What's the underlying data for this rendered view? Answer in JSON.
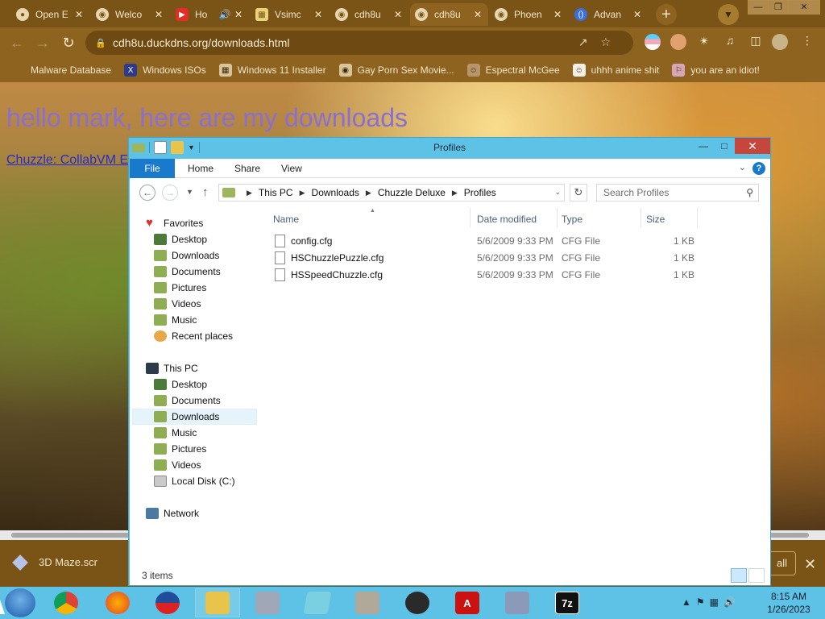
{
  "browser": {
    "tabs": [
      {
        "title": "Open E",
        "icon": "github-icon"
      },
      {
        "title": "Welco",
        "icon": "globe-icon"
      },
      {
        "title": "Ho",
        "icon": "youtube-icon"
      },
      {
        "title": "Vsimc",
        "icon": "vsim-icon"
      },
      {
        "title": "cdh8u",
        "icon": "globe-icon"
      },
      {
        "title": "cdh8u",
        "icon": "globe-icon"
      },
      {
        "title": "Phoen",
        "icon": "globe-icon"
      },
      {
        "title": "Advan",
        "icon": "advan-icon"
      }
    ],
    "active_tab_index": 5,
    "new_tab": "+",
    "url": "cdh8u.duckdns.org/downloads.html",
    "bookmarks": [
      "Malware Database",
      "Windows ISOs",
      "Windows 11 Installer",
      "Gay Porn Sex Movie...",
      "Espectral McGee",
      "uhhh anime shit",
      "you are an idiot!"
    ],
    "colors": {
      "frame": "#7a5416",
      "toolbar": "#8e6320"
    }
  },
  "webpage": {
    "heading": "hello mark, here are my downloads",
    "link": "Chuzzle: CollabVM Ed"
  },
  "download_bar": {
    "item": "3D Maze.scr",
    "show_all": "all"
  },
  "explorer": {
    "title": "Profiles",
    "ribbon_tabs": [
      "File",
      "Home",
      "Share",
      "View"
    ],
    "breadcrumb": [
      "This PC",
      "Downloads",
      "Chuzzle Deluxe",
      "Profiles"
    ],
    "search_placeholder": "Search Profiles",
    "nav": {
      "favorites_label": "Favorites",
      "favorites": [
        "Desktop",
        "Downloads",
        "Documents",
        "Pictures",
        "Videos",
        "Music",
        "Recent places"
      ],
      "thispc_label": "This PC",
      "thispc": [
        "Desktop",
        "Documents",
        "Downloads",
        "Music",
        "Pictures",
        "Videos",
        "Local Disk (C:)"
      ],
      "network_label": "Network",
      "selected": "Downloads"
    },
    "columns": [
      "Name",
      "Date modified",
      "Type",
      "Size"
    ],
    "files": [
      {
        "name": "config.cfg",
        "date": "5/6/2009 9:33 PM",
        "type": "CFG File",
        "size": "1 KB"
      },
      {
        "name": "HSChuzzlePuzzle.cfg",
        "date": "5/6/2009 9:33 PM",
        "type": "CFG File",
        "size": "1 KB"
      },
      {
        "name": "HSSpeedChuzzle.cfg",
        "date": "5/6/2009 9:33 PM",
        "type": "CFG File",
        "size": "1 KB"
      }
    ],
    "status": "3 items",
    "accent": "#1979ca"
  },
  "taskbar": {
    "time": "8:15 AM",
    "date": "1/26/2023",
    "items": [
      "chrome-icon",
      "firefox-icon",
      "obama-icon",
      "file-explorer-icon",
      "installer-icon",
      "notepad-icon",
      "archive-icon",
      "obs-icon",
      "adobe-icon",
      "setup-icon",
      "7zip-icon"
    ],
    "sevenzip_label": "7z",
    "color": "#5ec2e6"
  }
}
